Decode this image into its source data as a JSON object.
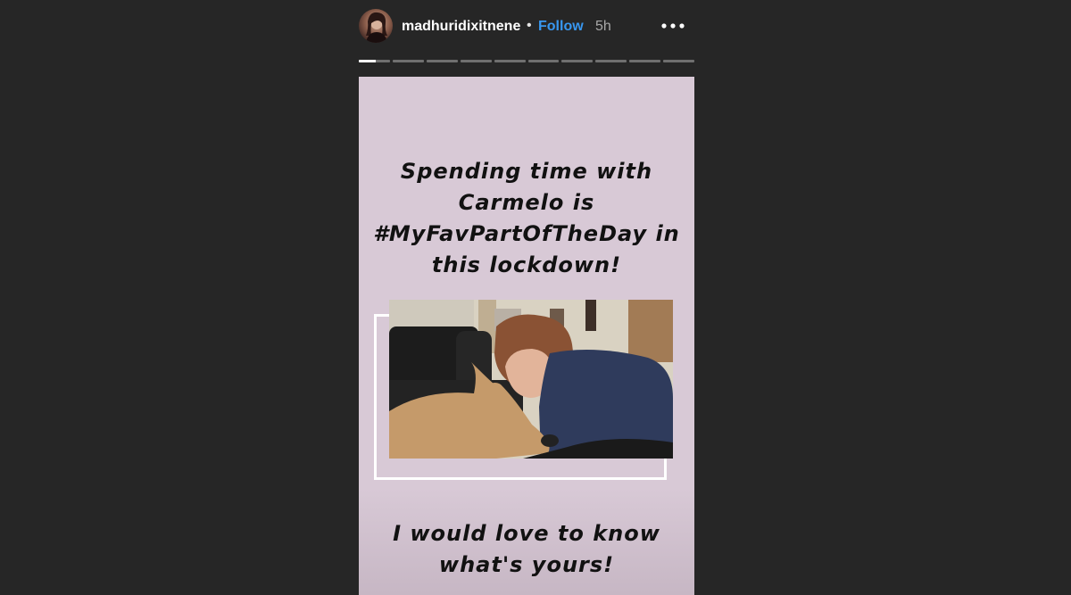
{
  "header": {
    "username": "madhuridixitnene",
    "separator": "•",
    "follow_label": "Follow",
    "timestamp": "5h"
  },
  "progress": {
    "segments": 10,
    "current_segment": 1,
    "current_fraction": 0.55
  },
  "story": {
    "caption_top": "Spending time with Carmelo is #MyFavPartOfTheDay in this lockdown!",
    "caption_bottom": "I would love to know what's yours!"
  },
  "colors": {
    "background": "#262626",
    "story_bg": "#d8c9d6",
    "follow": "#3897f0",
    "caption_text": "#111111"
  },
  "icons": {
    "more": "more-horizontal-icon"
  }
}
